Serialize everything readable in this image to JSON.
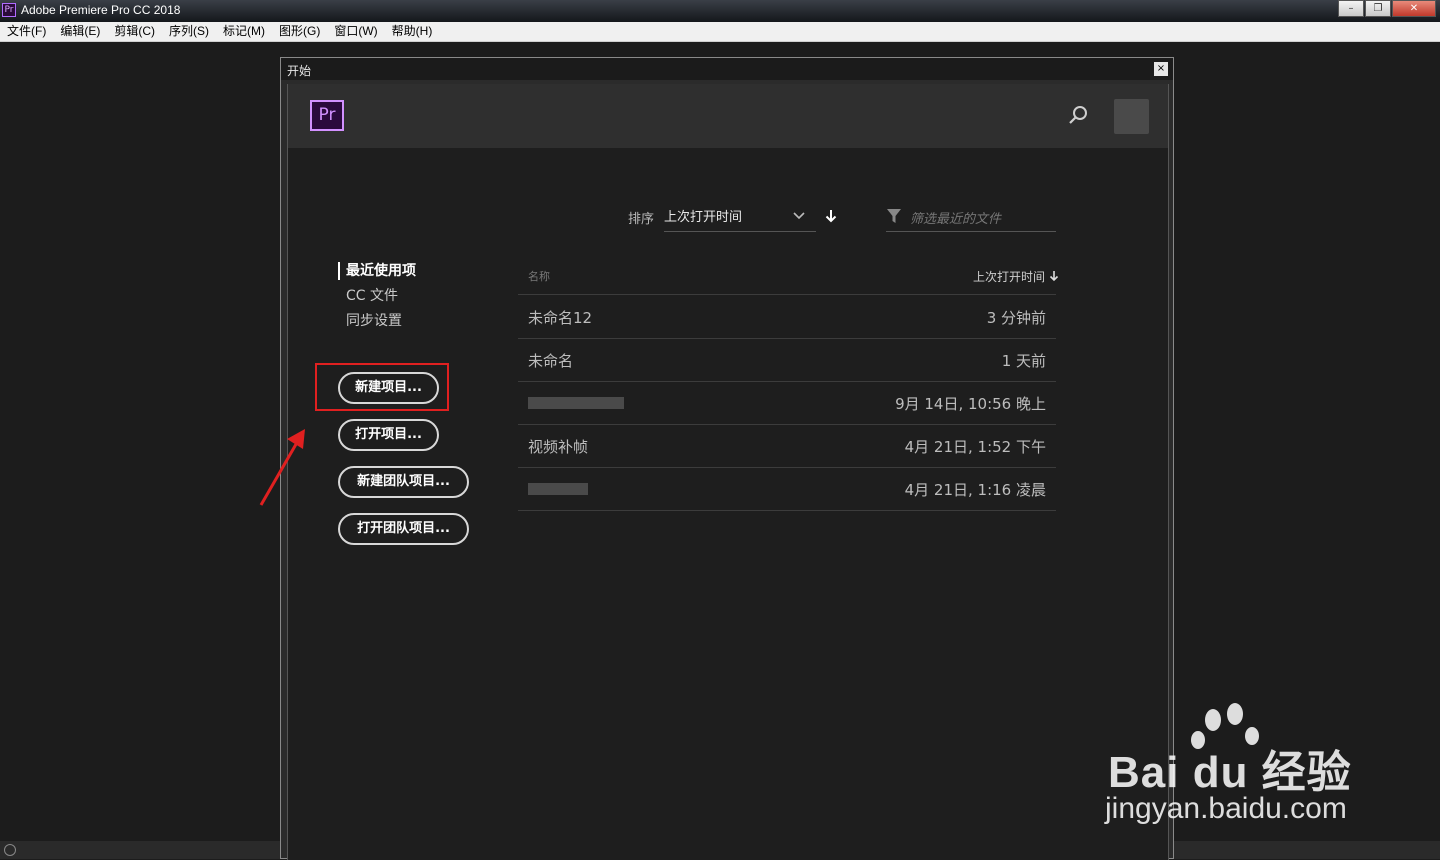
{
  "window": {
    "title": "Adobe Premiere Pro CC 2018",
    "icon_text": "Pr",
    "controls": [
      "minimize",
      "restore",
      "close"
    ]
  },
  "menu": [
    {
      "label": "文件(F)"
    },
    {
      "label": "编辑(E)"
    },
    {
      "label": "剪辑(C)"
    },
    {
      "label": "序列(S)"
    },
    {
      "label": "标记(M)"
    },
    {
      "label": "图形(G)"
    },
    {
      "label": "窗口(W)"
    },
    {
      "label": "帮助(H)"
    }
  ],
  "dialog": {
    "caption": "开始",
    "close_glyph": "×",
    "logo_text": "Pr",
    "sort": {
      "label": "排序",
      "value": "上次打开时间"
    },
    "filter": {
      "placeholder": "筛选最近的文件"
    },
    "nav": [
      {
        "label": "最近使用项",
        "active": true
      },
      {
        "label": "CC 文件",
        "active": false
      },
      {
        "label": "同步设置",
        "active": false
      }
    ],
    "buttons": [
      {
        "label": "新建项目..."
      },
      {
        "label": "打开项目..."
      },
      {
        "label": "新建团队项目..."
      },
      {
        "label": "打开团队项目..."
      }
    ],
    "table": {
      "col_name": "名称",
      "col_time": "上次打开时间",
      "rows": [
        {
          "name": "未命名12",
          "time": "3 分钟前"
        },
        {
          "name": "未命名",
          "time": "1 天前"
        },
        {
          "name": "",
          "time": "9月 14日, 10:56 晚上",
          "redacted": true
        },
        {
          "name": "视频补帧",
          "time": "4月 21日, 1:52 下午"
        },
        {
          "name": "",
          "time": "4月 21日, 1:16 凌晨",
          "redacted": true
        }
      ]
    }
  },
  "watermark": {
    "brand": "Bai du 经验",
    "url": "jingyan.baidu.com"
  },
  "colors": {
    "accent_pr": "#d291ff",
    "highlight": "#e02020",
    "background": "#1c1c1c"
  }
}
